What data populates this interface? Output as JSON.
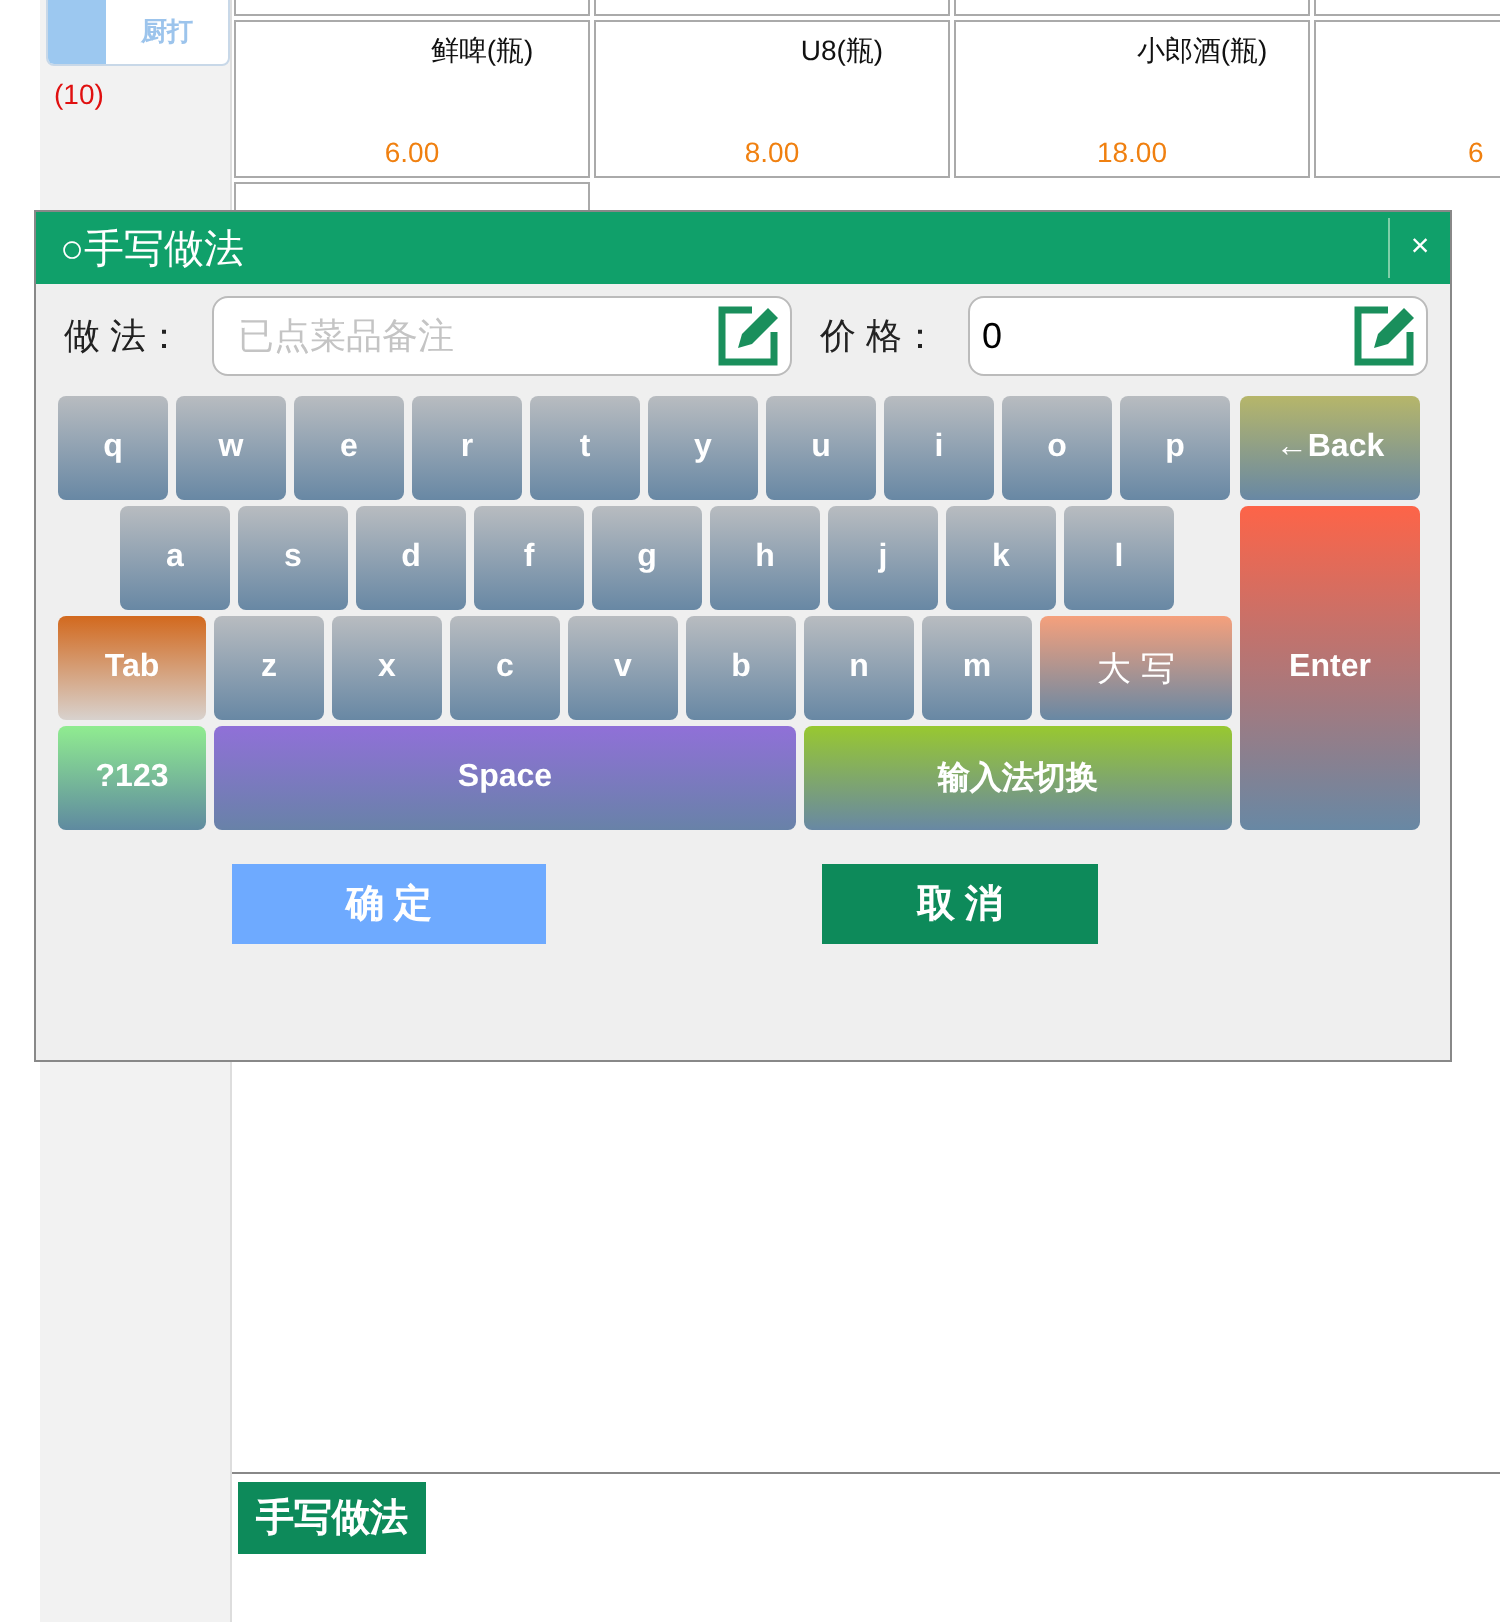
{
  "sidebar": {
    "category_tile": {
      "label": "厨打"
    },
    "count": "(10)"
  },
  "products": [
    {
      "name": "鲜啤(瓶)",
      "price": "6.00"
    },
    {
      "name": "U8(瓶)",
      "price": "8.00"
    },
    {
      "name": "小郎酒(瓶)",
      "price": "18.00"
    },
    {
      "price": "6"
    }
  ],
  "dialog": {
    "title": "○手写做法",
    "close": "×",
    "fields": [
      {
        "label": "做 法：",
        "placeholder": "已点菜品备注"
      },
      {
        "label": "价 格：",
        "value": "0"
      }
    ],
    "keyboard": {
      "main_rows": [
        [
          {
            "label": "q",
            "kind": "letter"
          },
          {
            "label": "w",
            "kind": "letter"
          },
          {
            "label": "e",
            "kind": "letter"
          },
          {
            "label": "r",
            "kind": "letter"
          },
          {
            "label": "t",
            "kind": "letter"
          },
          {
            "label": "y",
            "kind": "letter"
          },
          {
            "label": "u",
            "kind": "letter"
          },
          {
            "label": "i",
            "kind": "letter"
          },
          {
            "label": "o",
            "kind": "letter"
          },
          {
            "label": "p",
            "kind": "letter"
          }
        ],
        [
          {
            "label": "a",
            "kind": "letter"
          },
          {
            "label": "s",
            "kind": "letter"
          },
          {
            "label": "d",
            "kind": "letter"
          },
          {
            "label": "f",
            "kind": "letter"
          },
          {
            "label": "g",
            "kind": "letter"
          },
          {
            "label": "h",
            "kind": "letter"
          },
          {
            "label": "j",
            "kind": "letter"
          },
          {
            "label": "k",
            "kind": "letter"
          },
          {
            "label": "l",
            "kind": "letter"
          }
        ],
        [
          {
            "label": "Tab",
            "kind": "tab"
          },
          {
            "label": "z",
            "kind": "letter"
          },
          {
            "label": "x",
            "kind": "letter"
          },
          {
            "label": "c",
            "kind": "letter"
          },
          {
            "label": "v",
            "kind": "letter"
          },
          {
            "label": "b",
            "kind": "letter"
          },
          {
            "label": "n",
            "kind": "letter"
          },
          {
            "label": "m",
            "kind": "letter"
          },
          {
            "label": "大 写",
            "kind": "caps"
          }
        ],
        [
          {
            "label": "?123",
            "kind": "num"
          },
          {
            "label": "Space",
            "kind": "space"
          },
          {
            "label": "输入法切换",
            "kind": "ime"
          }
        ]
      ],
      "side_keys": [
        {
          "label": "←Back",
          "kind": "back"
        },
        {
          "label": "Enter",
          "kind": "enter"
        }
      ]
    },
    "buttons": [
      {
        "label": "确 定",
        "kind": "confirm"
      },
      {
        "label": "取 消",
        "kind": "cancel"
      }
    ]
  },
  "bottom_panel": {
    "tag": "手写做法"
  }
}
